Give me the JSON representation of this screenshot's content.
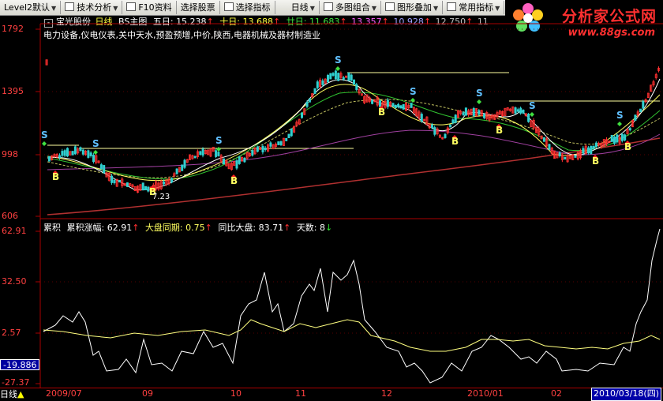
{
  "toolbar": {
    "items": [
      {
        "label": "Level2默认",
        "dropdown": true
      },
      {
        "label": "技术分析",
        "dropdown": true
      },
      {
        "label": "F10资料",
        "dropdown": false
      },
      {
        "label": "选择股票",
        "dropdown": false
      },
      {
        "label": "选择指标",
        "dropdown": false
      },
      {
        "label": "日线",
        "dropdown": true
      },
      {
        "label": "多图组合",
        "dropdown": true
      },
      {
        "label": "图形叠加",
        "dropdown": true
      },
      {
        "label": "常用指标",
        "dropdown": true
      }
    ]
  },
  "brand": {
    "title": "分析家公式网",
    "url": "www.88gs.com",
    "color": "#ff2020"
  },
  "header": {
    "stock_name": "宝光股份",
    "period": "日线",
    "indicator": "BS主图",
    "ma5_label": "五日:",
    "ma5_value": "15.238",
    "ma10_label": "十日:",
    "ma10_value": "13.688",
    "ma20_label": "廿日:",
    "ma20_value": "11.683",
    "val4": "13.357",
    "val5": "10.928",
    "val6": "12.750",
    "val7": "11"
  },
  "sectors": "电力设备,仪电仪表,关中天水,预盈预增,中价,陕西,电器机械及器材制造业",
  "price_axis": {
    "labels": [
      "1792",
      "1395",
      "998",
      "606"
    ]
  },
  "low_label": "7.23",
  "lower_panel": {
    "name": "累积",
    "gain_label": "累积涨幅:",
    "gain_value": "62.91",
    "market_label": "大盘同期:",
    "market_value": "0.75",
    "compare_label": "同比大盘:",
    "compare_value": "83.71",
    "days_label": "天数:",
    "days_value": "8",
    "axis_labels": [
      "62.91",
      "32.50",
      "2.57",
      "-27.37"
    ],
    "current_value": "-19.886"
  },
  "time_axis": {
    "labels": [
      "2009/07",
      "09",
      "10",
      "11",
      "12",
      "2010/01",
      "02"
    ]
  },
  "status_label": "日线",
  "date_box": "2010/03/18(四)",
  "colors": {
    "up": "#ff3030",
    "down": "#30d0d0",
    "axis_red": "#aa0000",
    "buy": "#ffff60",
    "sell": "#60c0ff"
  }
}
